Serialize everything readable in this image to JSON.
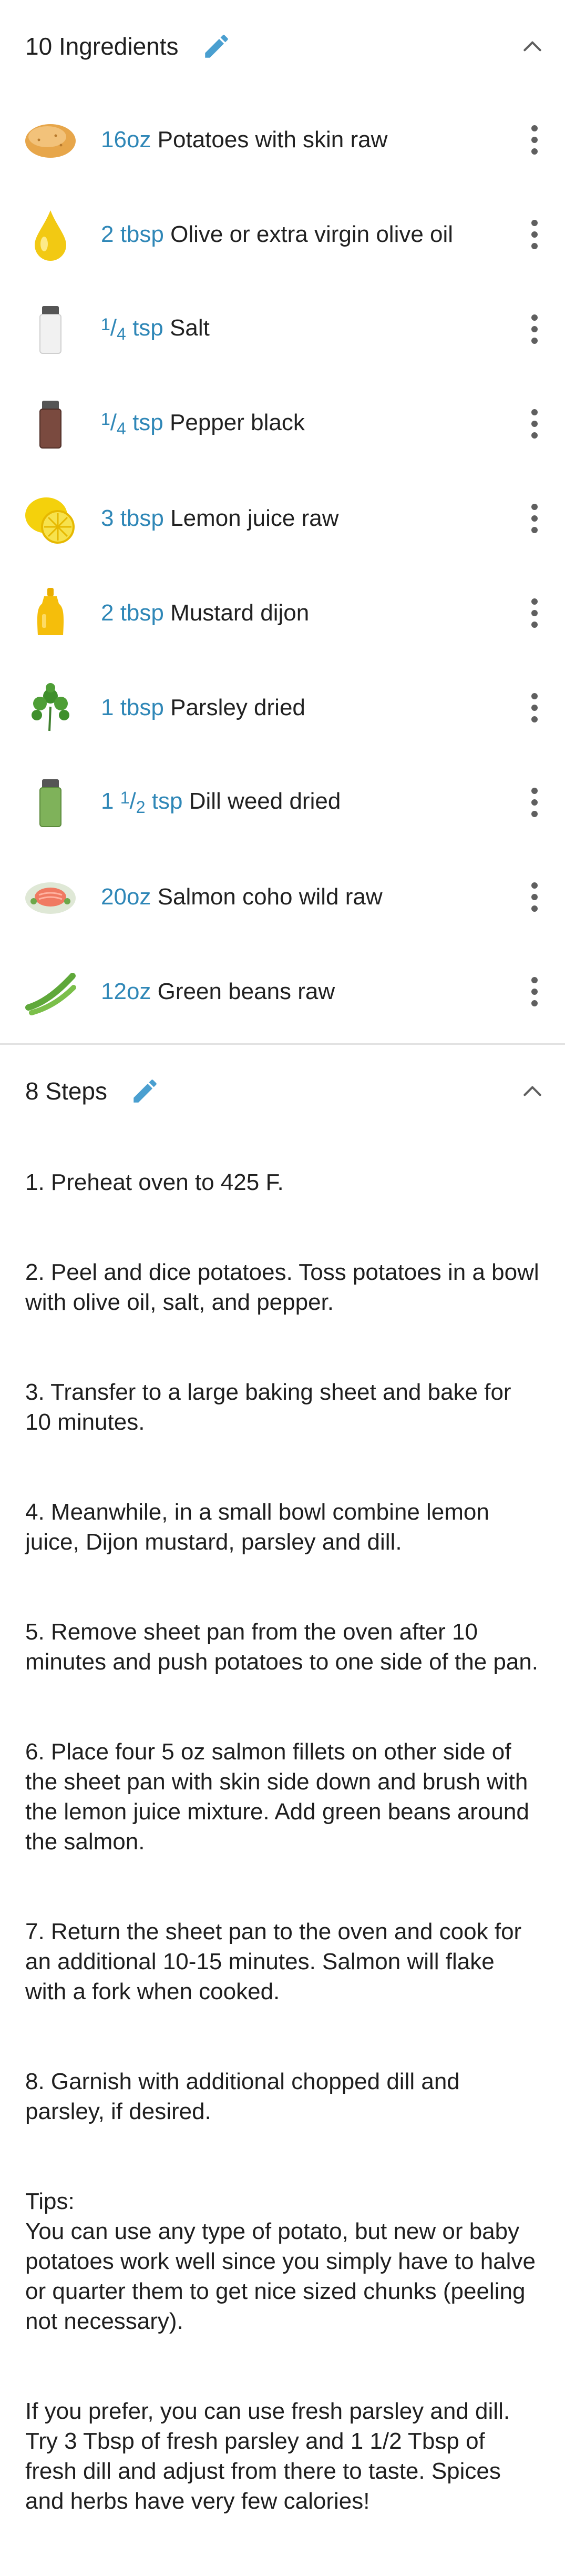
{
  "ingredients": {
    "title": "10 Ingredients",
    "edit_icon": "pencil-icon",
    "collapse_icon": "chevron-up-icon",
    "items": [
      {
        "qty_html_parts": {
          "whole": "",
          "num": "",
          "den": "",
          "plain": "16oz"
        },
        "name": "Potatoes with skin raw",
        "icon": "potato-icon"
      },
      {
        "qty_html_parts": {
          "whole": "",
          "num": "",
          "den": "",
          "plain": "2 tbsp"
        },
        "name": "Olive or extra virgin olive oil",
        "icon": "oil-drop-icon"
      },
      {
        "qty_html_parts": {
          "whole": "",
          "num": "1",
          "den": "4",
          "plain": "tsp"
        },
        "name": "Salt",
        "icon": "salt-shaker-icon"
      },
      {
        "qty_html_parts": {
          "whole": "",
          "num": "1",
          "den": "4",
          "plain": "tsp"
        },
        "name": "Pepper black",
        "icon": "pepper-shaker-icon"
      },
      {
        "qty_html_parts": {
          "whole": "",
          "num": "",
          "den": "",
          "plain": "3 tbsp"
        },
        "name": "Lemon juice raw",
        "icon": "lemon-icon"
      },
      {
        "qty_html_parts": {
          "whole": "",
          "num": "",
          "den": "",
          "plain": "2 tbsp"
        },
        "name": "Mustard dijon",
        "icon": "mustard-bottle-icon"
      },
      {
        "qty_html_parts": {
          "whole": "",
          "num": "",
          "den": "",
          "plain": "1 tbsp"
        },
        "name": "Parsley dried",
        "icon": "parsley-icon"
      },
      {
        "qty_html_parts": {
          "whole": "1",
          "num": "1",
          "den": "2",
          "plain": "tsp"
        },
        "name": "Dill weed dried",
        "icon": "dill-jar-icon"
      },
      {
        "qty_html_parts": {
          "whole": "",
          "num": "",
          "den": "",
          "plain": "20oz"
        },
        "name": "Salmon coho wild raw",
        "icon": "salmon-icon"
      },
      {
        "qty_html_parts": {
          "whole": "",
          "num": "",
          "den": "",
          "plain": "12oz"
        },
        "name": "Green beans raw",
        "icon": "green-beans-icon"
      }
    ]
  },
  "steps": {
    "title": "8 Steps",
    "edit_icon": "pencil-icon",
    "collapse_icon": "chevron-up-icon",
    "paragraphs": [
      "1. Preheat oven to 425 F.",
      "2. Peel and dice potatoes.  Toss potatoes in a bowl with olive oil, salt, and pepper.",
      "3. Transfer to a large baking sheet and bake for 10 minutes.",
      "4. Meanwhile, in a small bowl combine lemon juice, Dijon mustard, parsley and dill.",
      "5. Remove sheet pan from the oven after 10 minutes and push potatoes to one side of the pan.",
      "6. Place four 5 oz salmon fillets on other side of the sheet pan with skin side down and brush with the lemon juice mixture. Add green beans around the salmon.",
      "7. Return the sheet pan to the oven and cook for an additional 10-15 minutes. Salmon will flake with a fork when cooked.",
      "8. Garnish with additional chopped dill and parsley, if desired.",
      "Tips:\nYou can use any type of potato, but new or baby potatoes work well since you simply have to halve or quarter them to get nice sized chunks (peeling not necessary).",
      "If you prefer, you can use fresh parsley and dill.  Try 3 Tbsp of fresh parsley and 1 1/2 Tbsp of fresh dill and adjust from there to taste.  Spices and herbs have very few calories!"
    ]
  },
  "colors": {
    "accent": "#2f87b7",
    "icon_blue": "#4a9fd0",
    "text": "#1f1f1f"
  }
}
